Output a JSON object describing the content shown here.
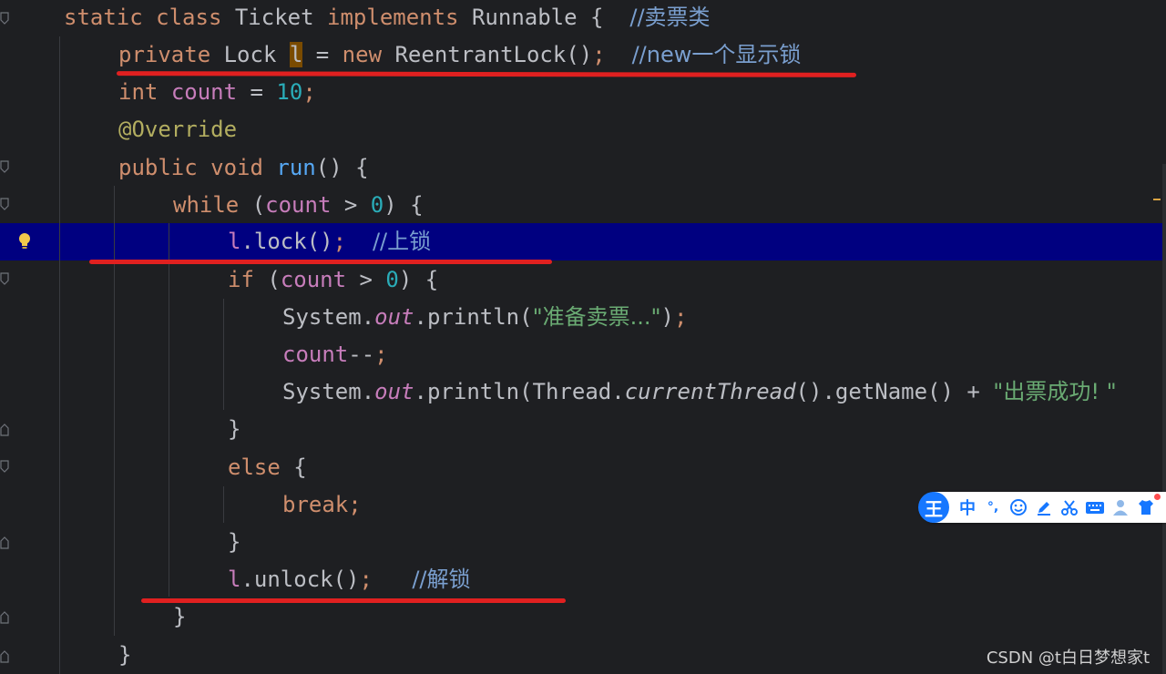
{
  "code": {
    "l1": {
      "kw1": "static",
      "kw2": "class",
      "name": "Ticket",
      "kw3": "implements",
      "iface": "Runnable",
      "brace": "{",
      "comment": "//卖票类"
    },
    "l2": {
      "kw1": "private",
      "type": "Lock",
      "var": "l",
      "eq": "=",
      "kw2": "new",
      "ctor": "ReentrantLock()",
      "semi": ";",
      "comment": "//new一个显示锁"
    },
    "l3": {
      "kw": "int",
      "field": "count",
      "eq": "=",
      "num": "10",
      "semi": ";"
    },
    "l4": {
      "ann": "@Override"
    },
    "l5": {
      "kw1": "public",
      "kw2": "void",
      "method": "run",
      "rest": "() {"
    },
    "l6": {
      "kw": "while",
      "open": "(",
      "field": "count",
      "op": ">",
      "num": "0",
      "close": ") {"
    },
    "l7": {
      "var": "l",
      "call": ".lock()",
      "semi": ";",
      "comment": "//上锁"
    },
    "l8": {
      "kw": "if",
      "open": "(",
      "field": "count",
      "op": ">",
      "num": "0",
      "close": ") {"
    },
    "l9": {
      "cls": "System.",
      "field": "out",
      "call": ".println(",
      "str": "\"准备卖票...\"",
      "close": ")",
      "semi": ";"
    },
    "l10": {
      "field": "count",
      "op": "--",
      "semi": ";"
    },
    "l11": {
      "cls": "System.",
      "field": "out",
      "call": ".println(Thread.",
      "static_call": "currentThread",
      "rest": "().getName() + ",
      "str": "\"出票成功! \""
    },
    "l12": {
      "brace": "}"
    },
    "l13": {
      "kw": "else",
      "brace": "{"
    },
    "l14": {
      "kw": "break",
      "semi": ";"
    },
    "l15": {
      "brace": "}"
    },
    "l16": {
      "var": "l",
      "call": ".unlock()",
      "semi": ";",
      "comment": "//解锁"
    },
    "l17": {
      "brace": "}"
    },
    "l18": {
      "brace": "}"
    }
  },
  "ime": {
    "logo": "王",
    "mode": "中",
    "punct": "°,",
    "emoji_icon": "smile-icon",
    "pen_icon": "pen-icon",
    "scissors_icon": "scissors-icon",
    "keyboard_icon": "keyboard-icon",
    "user_icon": "user-icon",
    "shirt_icon": "shirt-icon"
  },
  "watermark": "CSDN @t白日梦想家t",
  "colors": {
    "background": "#1e1f22",
    "keyword": "#cf8e6d",
    "field": "#c77dbb",
    "number": "#2aacb8",
    "string": "#6aab73",
    "annotation": "#b3ae60",
    "comment": "#7a9fcf",
    "line_highlight": "#000080",
    "annotation_underline": "#e02020"
  }
}
